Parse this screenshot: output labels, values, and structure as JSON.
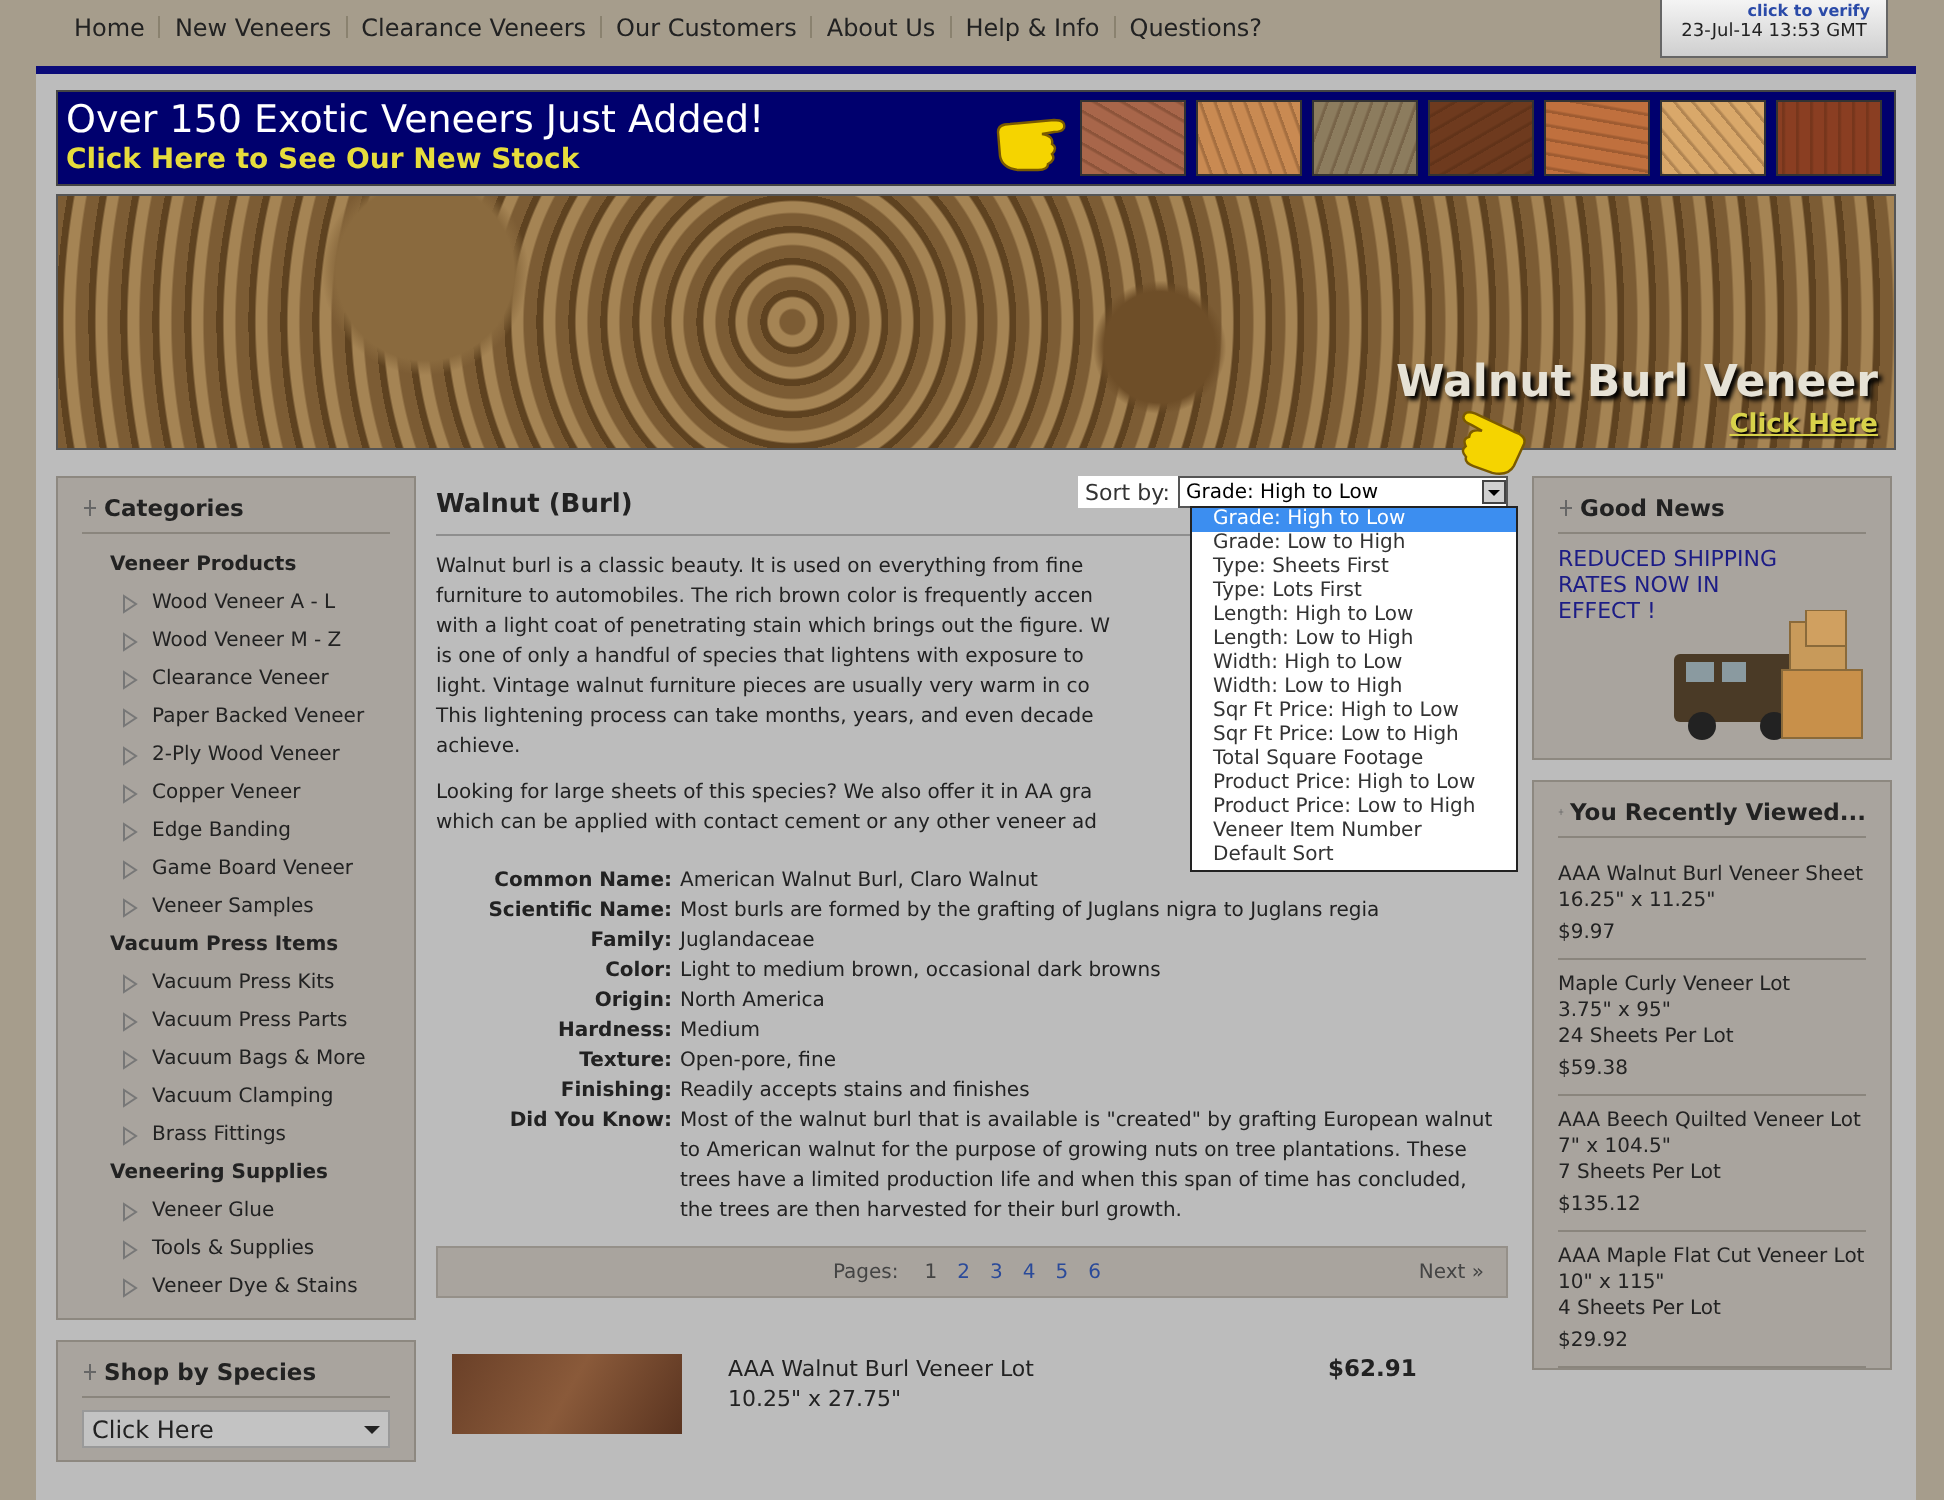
{
  "top_nav": {
    "links": [
      "Home",
      "New Veneers",
      "Clearance Veneers",
      "Our Customers",
      "About Us",
      "Help & Info",
      "Questions?"
    ],
    "verify_badge": {
      "caption": "click to verify",
      "date": "23-Jul-14 13:53 GMT"
    }
  },
  "promo_banner": {
    "headline": "Over 150 Exotic Veneers Just Added!",
    "link": "Click Here to See Our New Stock",
    "swatches": [
      {
        "color": "#a8664a"
      },
      {
        "color": "#c98a52"
      },
      {
        "color": "#8c7c5e"
      },
      {
        "color": "#6e3a1e"
      },
      {
        "color": "#c0703e"
      },
      {
        "color": "#d9a86a"
      },
      {
        "color": "#8a3e22"
      }
    ]
  },
  "hero": {
    "title": "Walnut Burl Veneer",
    "link": "Click Here"
  },
  "categories": {
    "title": "Categories",
    "groups": [
      {
        "heading": "Veneer Products",
        "items": [
          "Wood Veneer A - L",
          "Wood Veneer M - Z",
          "Clearance Veneer",
          "Paper Backed Veneer",
          "2-Ply Wood Veneer",
          "Copper Veneer",
          "Edge Banding",
          "Game Board Veneer",
          "Veneer Samples"
        ]
      },
      {
        "heading": "Vacuum Press Items",
        "items": [
          "Vacuum Press Kits",
          "Vacuum Press Parts",
          "Vacuum Bags & More",
          "Vacuum Clamping",
          "Brass Fittings"
        ]
      },
      {
        "heading": "Veneering Supplies",
        "items": [
          "Veneer Glue",
          "Tools & Supplies",
          "Veneer Dye & Stains"
        ]
      }
    ]
  },
  "shop_by_species": {
    "title": "Shop by Species",
    "select_value": "Click Here"
  },
  "main": {
    "title": "Walnut (Burl)",
    "sort": {
      "label": "Sort by:",
      "value": "Grade: High to Low",
      "options": [
        {
          "label": "Grade: High to Low",
          "selected": true
        },
        {
          "label": "Grade: Low to High",
          "selected": false
        },
        {
          "label": "Type: Sheets First",
          "selected": false
        },
        {
          "label": "Type: Lots First",
          "selected": false
        },
        {
          "label": "Length: High to Low",
          "selected": false
        },
        {
          "label": "Length: Low to High",
          "selected": false
        },
        {
          "label": "Width: High to Low",
          "selected": false
        },
        {
          "label": "Width: Low to High",
          "selected": false
        },
        {
          "label": "Sqr Ft Price: High to Low",
          "selected": false
        },
        {
          "label": "Sqr Ft Price: Low to High",
          "selected": false
        },
        {
          "label": "Total Square Footage",
          "selected": false
        },
        {
          "label": "Product Price: High to Low",
          "selected": false
        },
        {
          "label": "Product Price: Low to High",
          "selected": false
        },
        {
          "label": "Veneer Item Number",
          "selected": false
        },
        {
          "label": "Default Sort",
          "selected": false
        }
      ]
    },
    "paragraphs": [
      [
        "Walnut burl is a classic beauty. It is used on everything from fine",
        "furniture to automobiles. The rich brown color is frequently accen",
        "with a light coat of penetrating stain which brings out the figure. W",
        "is one of only a handful of species that lightens with exposure to",
        "light. Vintage walnut furniture pieces are usually very warm in co",
        "This lightening process can take months, years, and even decade",
        "achieve."
      ],
      [
        "Looking for large sheets of this species? We also offer it in AA gra",
        "which can be applied with contact cement or any other veneer ad"
      ]
    ],
    "specs": [
      {
        "label": "Common Name:",
        "value": "American Walnut Burl, Claro Walnut"
      },
      {
        "label": "Scientific Name:",
        "value": "Most burls are formed by the grafting of Juglans nigra to Juglans regia"
      },
      {
        "label": "Family:",
        "value": "Juglandaceae"
      },
      {
        "label": "Color:",
        "value": "Light to medium brown, occasional dark browns"
      },
      {
        "label": "Origin:",
        "value": "North America"
      },
      {
        "label": "Hardness:",
        "value": "Medium"
      },
      {
        "label": "Texture:",
        "value": "Open-pore, fine"
      },
      {
        "label": "Finishing:",
        "value": "Readily accepts stains and finishes"
      },
      {
        "label": "Did You Know:",
        "value": "Most of the walnut burl that is available is \"created\" by grafting European walnut to American walnut for the purpose of growing nuts on tree plantations. These trees have a limited production life and when this span of time has concluded, the trees are then harvested for their burl growth."
      }
    ],
    "pagination": {
      "label": "Pages:",
      "pages": [
        {
          "label": "1",
          "selected": true
        },
        {
          "label": "2",
          "selected": false
        },
        {
          "label": "3",
          "selected": false
        },
        {
          "label": "4",
          "selected": false
        },
        {
          "label": "5",
          "selected": false
        },
        {
          "label": "6",
          "selected": false
        }
      ],
      "next": "Next »"
    },
    "products": [
      {
        "name": "AAA Walnut Burl Veneer Lot",
        "size": "10.25\" x 27.75\"",
        "price": "$62.91"
      }
    ]
  },
  "good_news": {
    "title": "Good News",
    "text": "REDUCED SHIPPING RATES NOW IN EFFECT !"
  },
  "recently_viewed": {
    "title": "You Recently Viewed...",
    "items": [
      {
        "name": "AAA Walnut Burl Veneer Sheet",
        "lines": [
          "16.25\" x 11.25\""
        ],
        "price": "$9.97"
      },
      {
        "name": "Maple Curly Veneer Lot",
        "lines": [
          "3.75\" x 95\"",
          "24 Sheets Per Lot"
        ],
        "price": "$59.38"
      },
      {
        "name": "AAA Beech Quilted Veneer Lot",
        "lines": [
          "7\" x 104.5\"",
          "7 Sheets Per Lot"
        ],
        "price": "$135.12"
      },
      {
        "name": "AAA Maple Flat Cut Veneer Lot",
        "lines": [
          "10\" x 115\"",
          "4 Sheets Per Lot"
        ],
        "price": "$29.92"
      }
    ]
  }
}
